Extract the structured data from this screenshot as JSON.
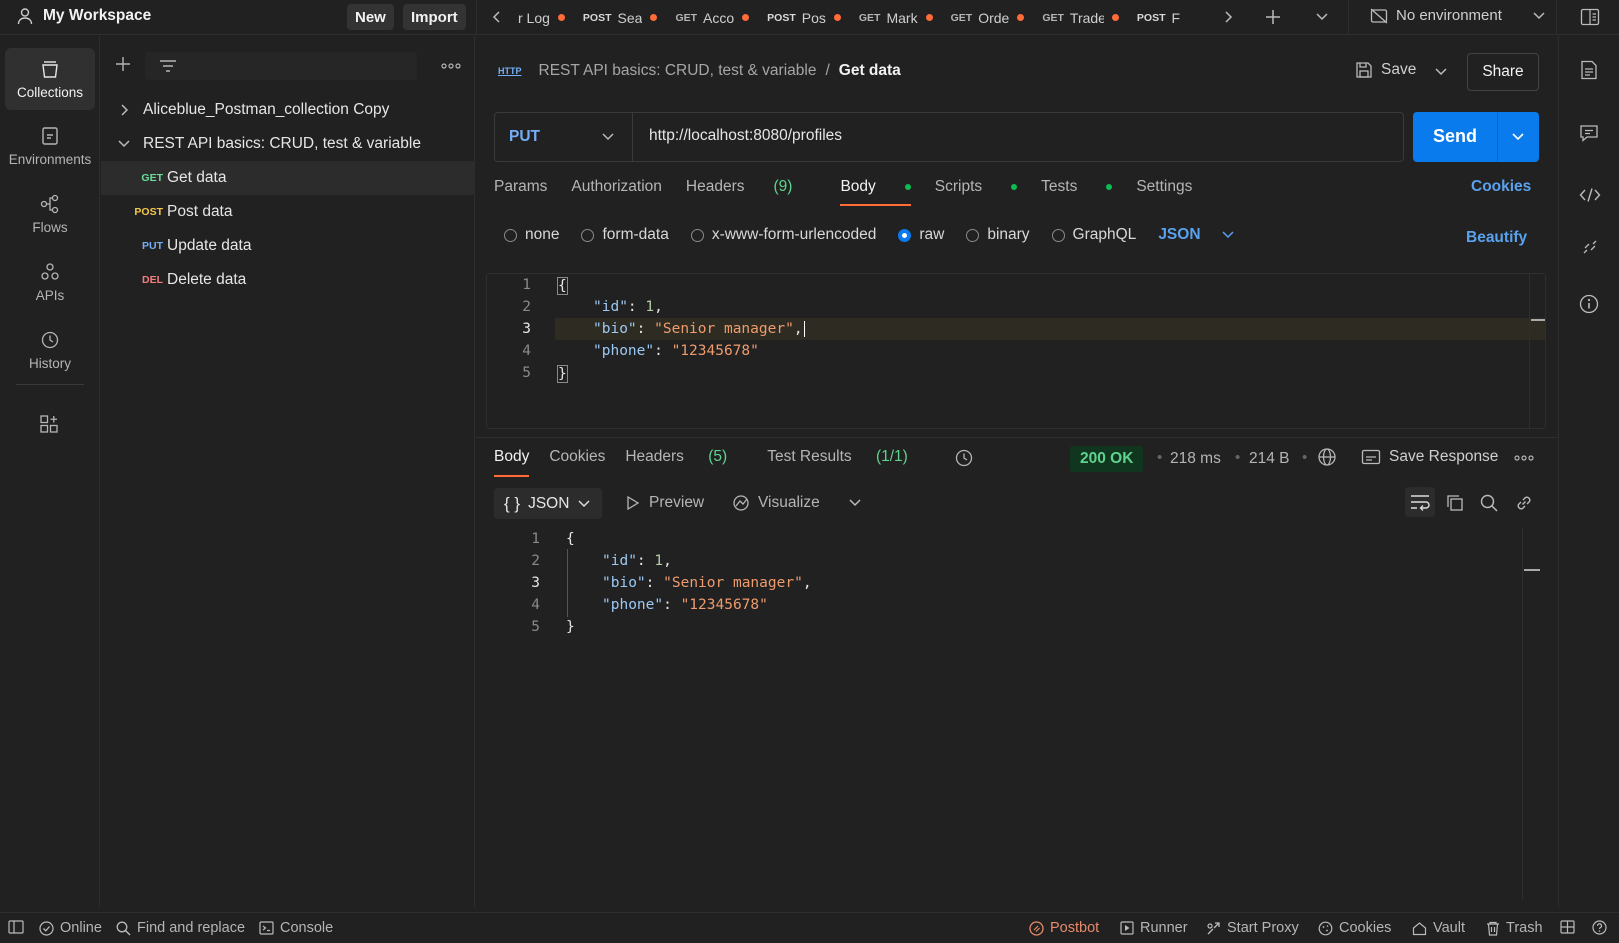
{
  "workspace": {
    "name": "My Workspace",
    "new_label": "New",
    "import_label": "Import"
  },
  "tabs": [
    {
      "method": "",
      "name": "r Log",
      "color": "#d0d0d0"
    },
    {
      "method": "POST",
      "name": "Sea",
      "color": "#f5c84c"
    },
    {
      "method": "GET",
      "name": "Acco",
      "color": "#6bdd9a"
    },
    {
      "method": "POST",
      "name": "Pos",
      "color": "#f5c84c"
    },
    {
      "method": "GET",
      "name": "Mark",
      "color": "#6bdd9a"
    },
    {
      "method": "GET",
      "name": "Orde",
      "color": "#6bdd9a"
    },
    {
      "method": "GET",
      "name": "Trade",
      "color": "#6bdd9a"
    },
    {
      "method": "POST",
      "name": "F",
      "color": "#f5c84c"
    }
  ],
  "environment": {
    "label": "No environment"
  },
  "rail": {
    "collections": "Collections",
    "environments": "Environments",
    "flows": "Flows",
    "apis": "APIs",
    "history": "History"
  },
  "collections_tree": {
    "c1": "Aliceblue_Postman_collection Copy",
    "c2": "REST API basics: CRUD, test & variable",
    "items": [
      {
        "method": "GET",
        "name": "Get data",
        "color": "#6bdd9a"
      },
      {
        "method": "POST",
        "name": "Post data",
        "color": "#f5c84c"
      },
      {
        "method": "PUT",
        "name": "Update data",
        "color": "#74aef6"
      },
      {
        "method": "DEL",
        "name": "Delete data",
        "color": "#f37e7e"
      }
    ]
  },
  "request": {
    "breadcrumb_collection": "REST API basics: CRUD, test & variable",
    "breadcrumb_sep": "/",
    "breadcrumb_current": "Get data",
    "http_badge": "HTTP",
    "save_label": "Save",
    "share_label": "Share",
    "method": "PUT",
    "url": "http://localhost:8080/profiles",
    "send_label": "Send",
    "tabs": {
      "params": "Params",
      "authorization": "Authorization",
      "headers": "Headers",
      "headers_count": "(9)",
      "body": "Body",
      "scripts": "Scripts",
      "tests": "Tests",
      "settings": "Settings"
    },
    "cookies_label": "Cookies",
    "body_modes": {
      "none": "none",
      "form_data": "form-data",
      "urlencoded": "x-www-form-urlencoded",
      "raw": "raw",
      "binary": "binary",
      "graphql": "GraphQL",
      "format": "JSON"
    },
    "beautify_label": "Beautify",
    "body_lines": {
      "l1": "{",
      "l2_key": "\"id\"",
      "l2_rest": ": ",
      "l2_val": "1",
      "l3_key": "\"bio\"",
      "l3_val": "\"Senior manager\"",
      "l4_key": "\"phone\"",
      "l4_val": "\"12345678\"",
      "l5": "}"
    }
  },
  "response": {
    "tabs": {
      "body": "Body",
      "cookies": "Cookies",
      "headers": "Headers",
      "headers_count": "(5)",
      "tests": "Test Results",
      "tests_count": "(1/1)"
    },
    "status": "200 OK",
    "time": "218 ms",
    "size": "214 B",
    "save_response": "Save Response",
    "format": "JSON",
    "preview": "Preview",
    "visualize": "Visualize",
    "body_lines": {
      "l1": "{",
      "l2_key": "\"id\"",
      "l2_val": "1",
      "l3_key": "\"bio\"",
      "l3_val": "\"Senior manager\"",
      "l4_key": "\"phone\"",
      "l4_val": "\"12345678\"",
      "l5": "}"
    }
  },
  "statusbar": {
    "online": "Online",
    "find_replace": "Find and replace",
    "console": "Console",
    "postbot": "Postbot",
    "runner": "Runner",
    "start_proxy": "Start Proxy",
    "cookies": "Cookies",
    "vault": "Vault",
    "trash": "Trash"
  },
  "colors": {
    "accent": "#097bed",
    "brand": "#ff6c37",
    "ok": "#5fd38d"
  }
}
